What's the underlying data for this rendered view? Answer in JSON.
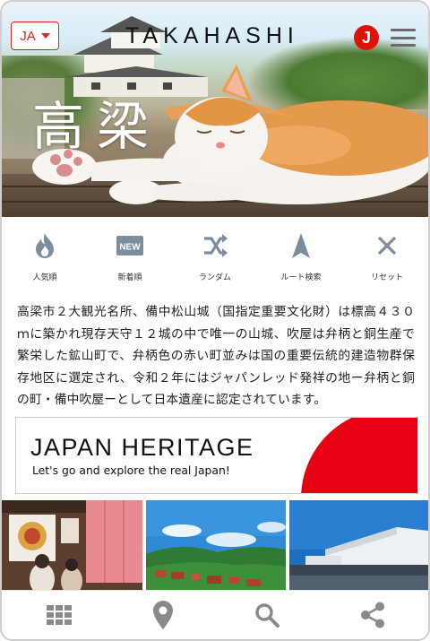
{
  "header": {
    "language_label": "JA",
    "brand": "TAKAHASHI",
    "badge_letter": "J",
    "hero_kanji": "高梁"
  },
  "actions": [
    {
      "label": "人気順",
      "icon": "flame-icon"
    },
    {
      "label": "新着順",
      "icon": "new-badge-icon"
    },
    {
      "label": "ランダム",
      "icon": "shuffle-icon"
    },
    {
      "label": "ルート検索",
      "icon": "navigation-arrow-icon"
    },
    {
      "label": "リセット",
      "icon": "close-icon"
    }
  ],
  "description": "高梁市２大観光名所、備中松山城（国指定重要文化財）は標高４３０ｍに築かれ現存天守１２城の中で唯一の山城、吹屋は弁柄と銅生産で繁栄した鉱山町で、弁柄色の赤い町並みは国の重要伝統的建造物群保存地区に選定され、令和２年にはジャパンレッド発祥の地ー弁柄と銅の町・備中吹屋ーとして日本遺産に認定されています。",
  "banner": {
    "title": "JAPAN HERITAGE",
    "subtitle": "Let's go and explore the real Japan!"
  },
  "bottom_nav": [
    {
      "icon": "grid-icon"
    },
    {
      "icon": "map-pin-icon"
    },
    {
      "icon": "search-icon"
    },
    {
      "icon": "share-icon"
    }
  ],
  "colors": {
    "accent_red": "#e0231b",
    "icon_gray": "#7d8da0",
    "nav_gray": "#8a8a8a"
  }
}
